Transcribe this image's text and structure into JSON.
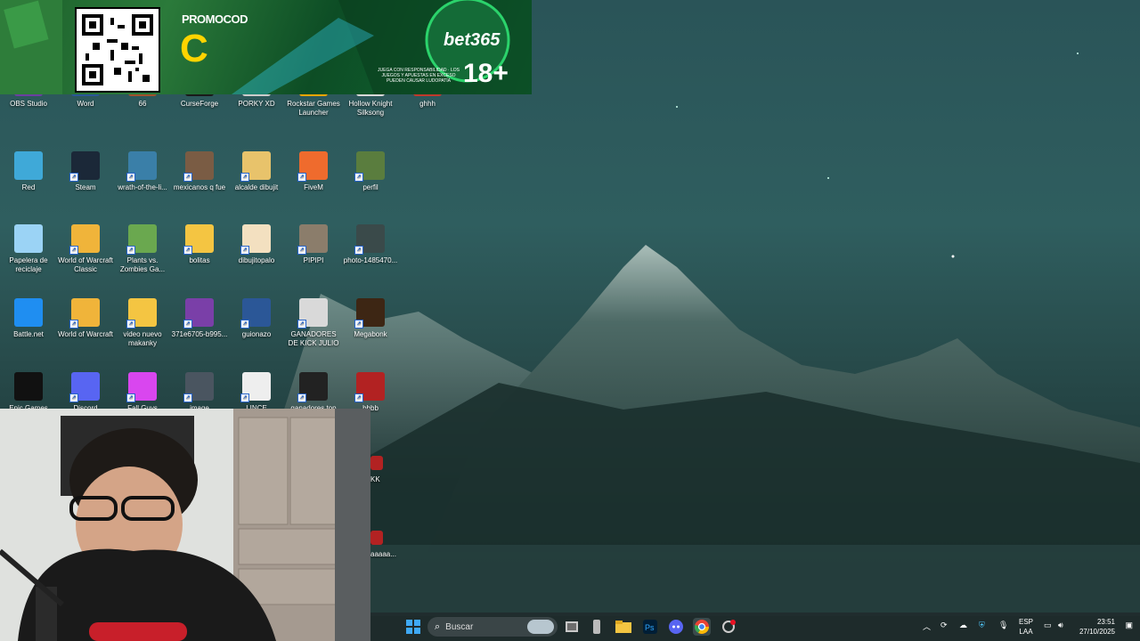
{
  "promo": {
    "label": "PROMOCOD",
    "code": "C",
    "brand": "bet365",
    "age": "18+",
    "disclaimer": "JUEGA CON RESPONSABILIDAD · LOS JUEGOS Y APUESTAS EN EXCESO PUEDEN CAUSAR LUDOPATÍA"
  },
  "desktop": {
    "row1": [
      "OBS Studio",
      "Word",
      "66",
      "CurseForge",
      "PORKY XD",
      "Rockstar Games Launcher",
      "Hollow Knight Silksong",
      "ghhh"
    ],
    "row2": [
      "Red",
      "Steam",
      "wrath-of-the-li...",
      "mexicanos q fue",
      "alcalde dibujit",
      "FiveM",
      "perfil"
    ],
    "row3": [
      "Papelera de reciclaje",
      "World of Warcraft Classic",
      "Plants vs. Zombies Ga...",
      "bolitas",
      "dibujitopalo",
      "PIPIPI",
      "photo-1485470..."
    ],
    "row4": [
      "Battle.net",
      "World of Warcraft",
      "video nuevo makanky",
      "371e6705-b995...",
      "guionazo",
      "GANADORES DE KICK JULIO",
      "Megabonk"
    ],
    "row5": [
      "Epic Games",
      "Discord",
      "Fall Guys",
      "image",
      "LINCE",
      "ganadores top",
      "bbbb"
    ],
    "partial": [
      "KK",
      "aaaaa..."
    ]
  },
  "taskbar": {
    "search_placeholder": "Buscar",
    "lang_top": "ESP",
    "lang_bottom": "LAA",
    "time": "23:51",
    "date": "27/10/2025"
  }
}
